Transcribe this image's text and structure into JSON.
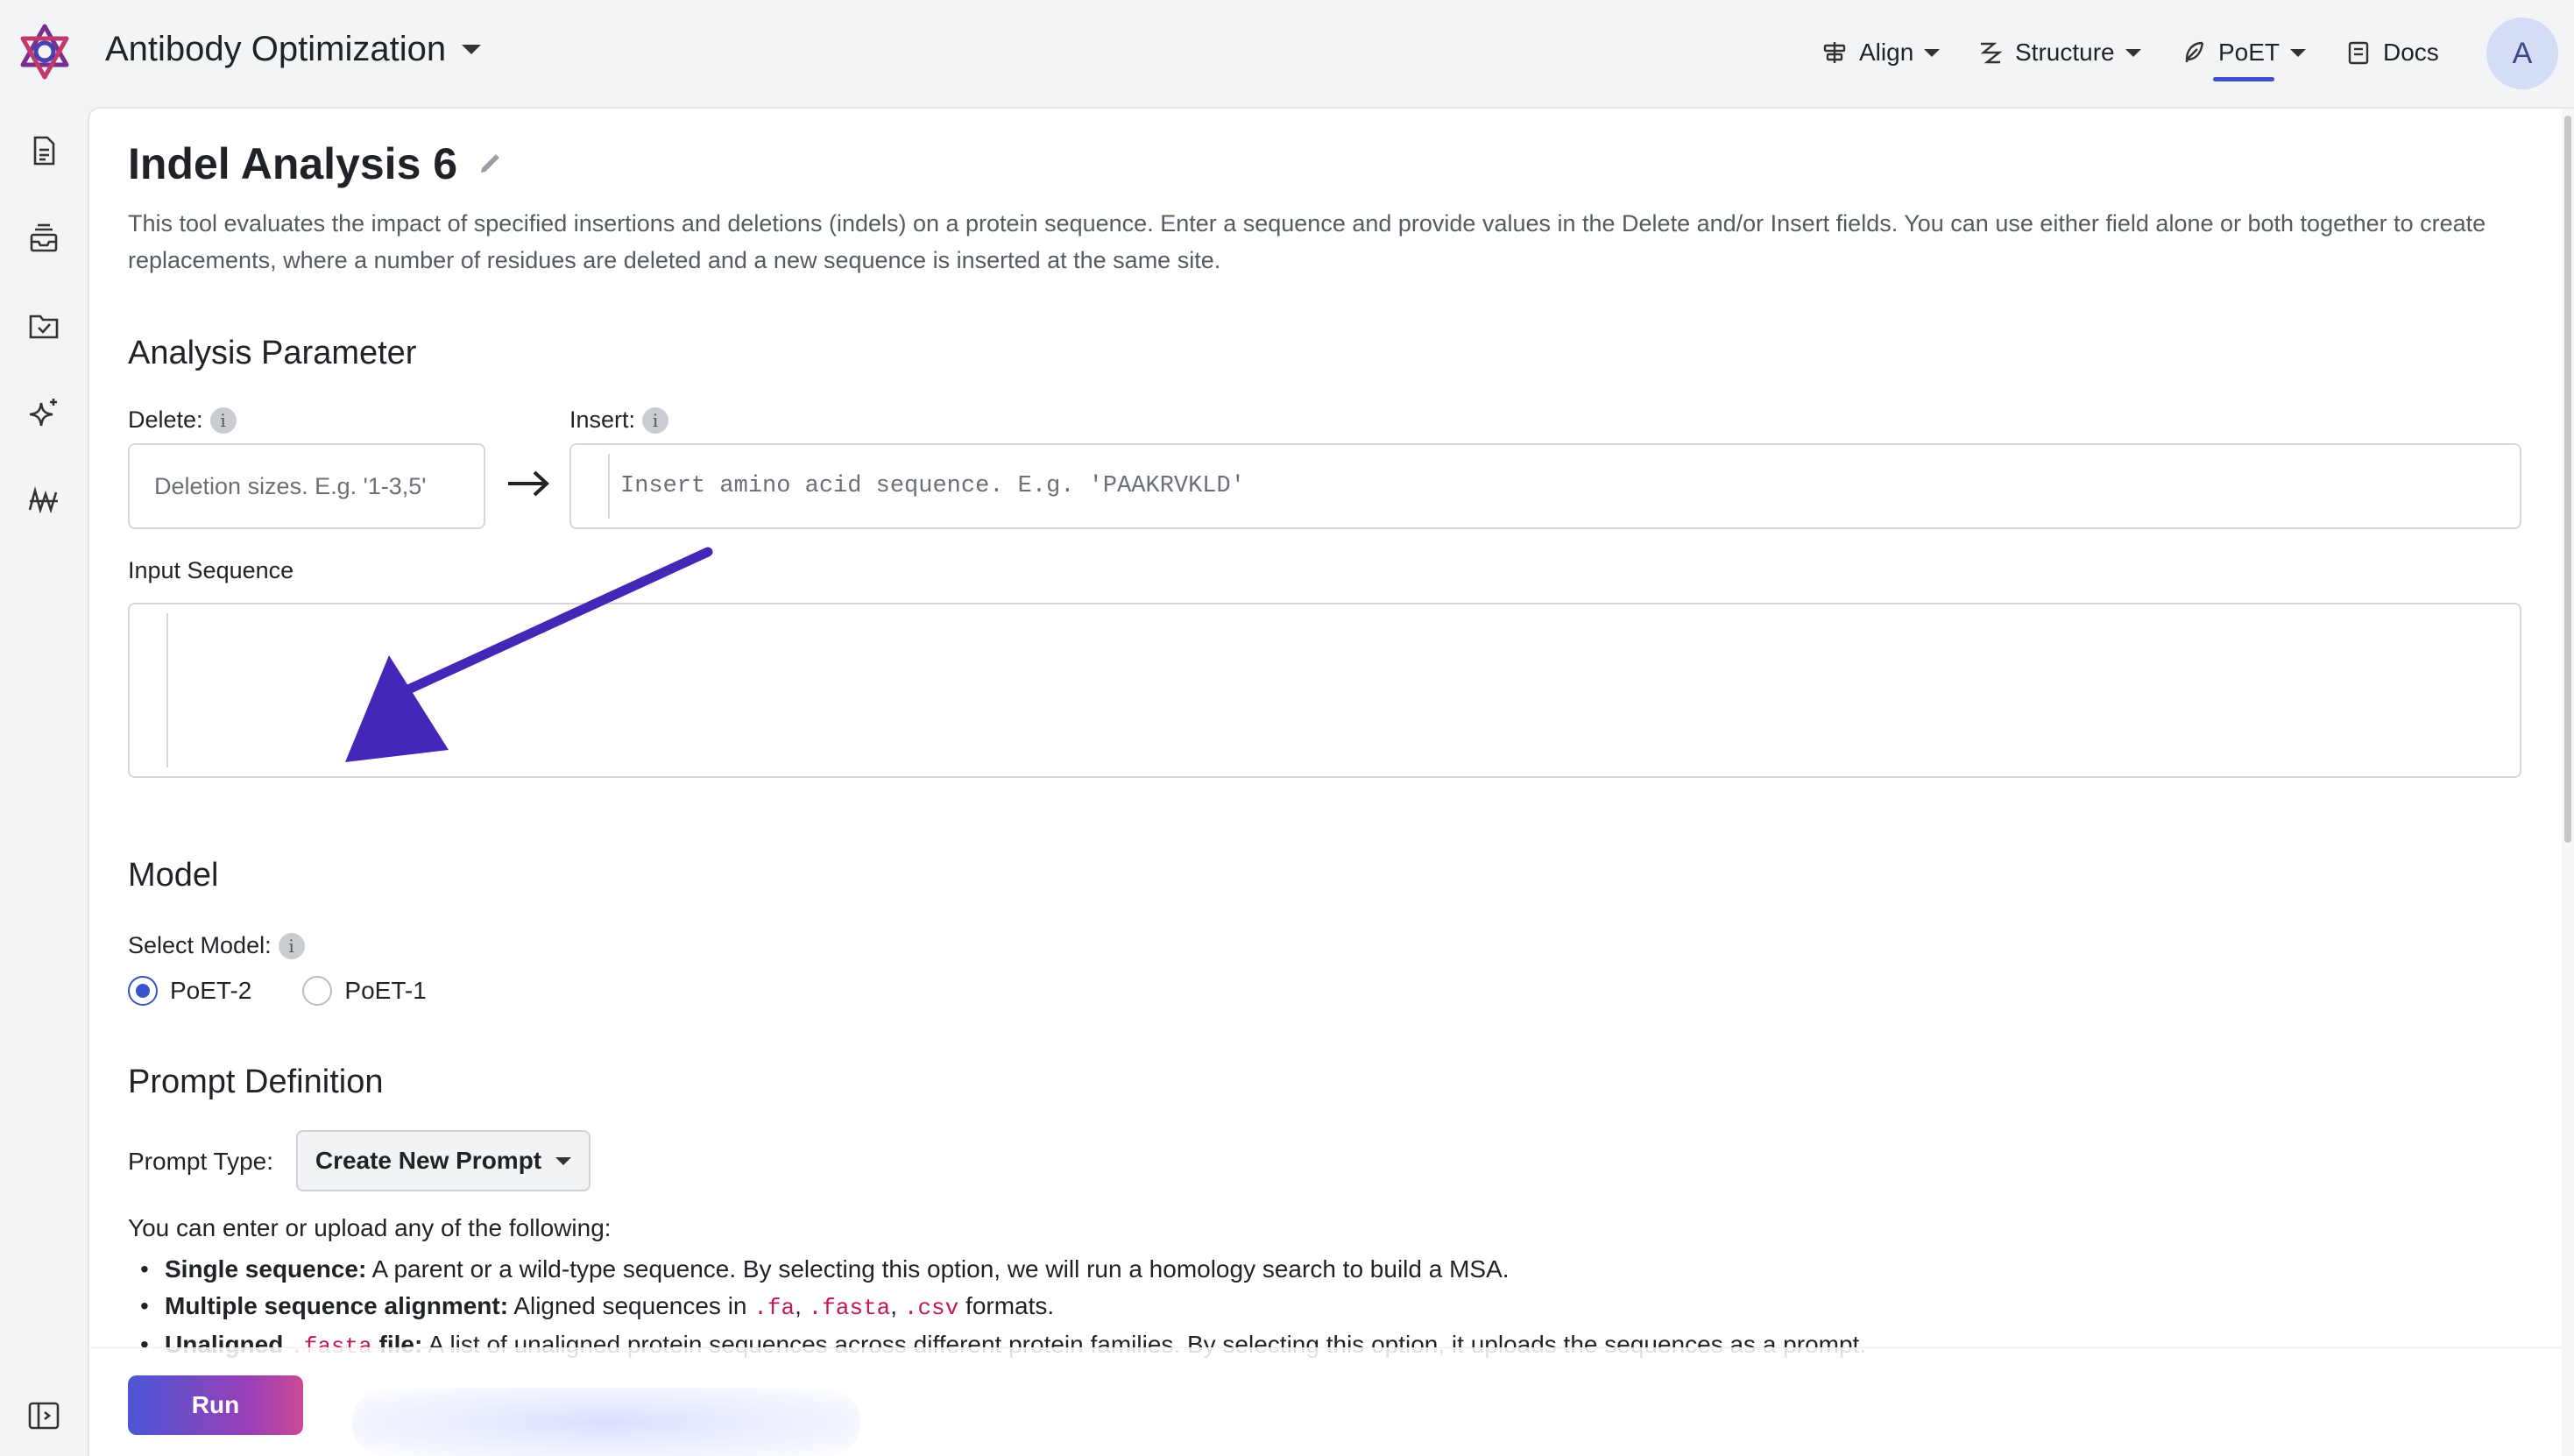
{
  "header": {
    "app_title": "Antibody Optimization",
    "nav": [
      {
        "label": "Align",
        "icon": "align-icon"
      },
      {
        "label": "Structure",
        "icon": "structure-icon"
      },
      {
        "label": "PoET",
        "icon": "feather-icon",
        "active": true
      },
      {
        "label": "Docs",
        "icon": "book-icon"
      }
    ],
    "avatar_initial": "A",
    "accent_color": "#3f51c8"
  },
  "sidebar": {
    "icons": [
      "document-icon",
      "inbox-stack-icon",
      "folder-check-icon",
      "sparkle-icon",
      "waveform-icon"
    ],
    "footer_icon": "expand-panel-icon"
  },
  "page": {
    "title": "Indel Analysis 6",
    "description": "This tool evaluates the impact of specified insertions and deletions (indels) on a protein sequence. Enter a sequence and provide values in the Delete and/or Insert fields. You can use either field alone or both together to create replacements, where a number of residues are deleted and a new sequence is inserted at the same site."
  },
  "analysis": {
    "section_title": "Analysis Parameter",
    "delete_label": "Delete:",
    "delete_placeholder": "Deletion sizes. E.g. '1-3,5'",
    "insert_label": "Insert:",
    "insert_placeholder": "Insert amino acid sequence. E.g. 'PAAKRVKLD'",
    "input_sequence_label": "Input Sequence",
    "input_sequence_value": ""
  },
  "model": {
    "section_title": "Model",
    "select_label": "Select Model:",
    "options": [
      {
        "label": "PoET-2",
        "selected": true
      },
      {
        "label": "PoET-1",
        "selected": false
      }
    ]
  },
  "prompt": {
    "section_title": "Prompt Definition",
    "type_label": "Prompt Type:",
    "type_value": "Create New Prompt",
    "intro": "You can enter or upload any of the following:",
    "items": [
      {
        "bold": "Single sequence:",
        "text": " A parent or a wild-type sequence. By selecting this option, we will run a homology search to build a MSA."
      },
      {
        "bold": "Multiple sequence alignment:",
        "text": " Aligned sequences in ",
        "codes": [
          ".fa",
          ".fasta",
          ".csv"
        ],
        "suffix": " formats."
      },
      {
        "bold": "Unaligned",
        "code": ".fasta",
        "bold2": "file:",
        "text": " A list of unaligned protein sequences across different protein families. By selecting this option, it uploads the sequences as a prompt."
      }
    ]
  },
  "footer": {
    "run_label": "Run"
  }
}
